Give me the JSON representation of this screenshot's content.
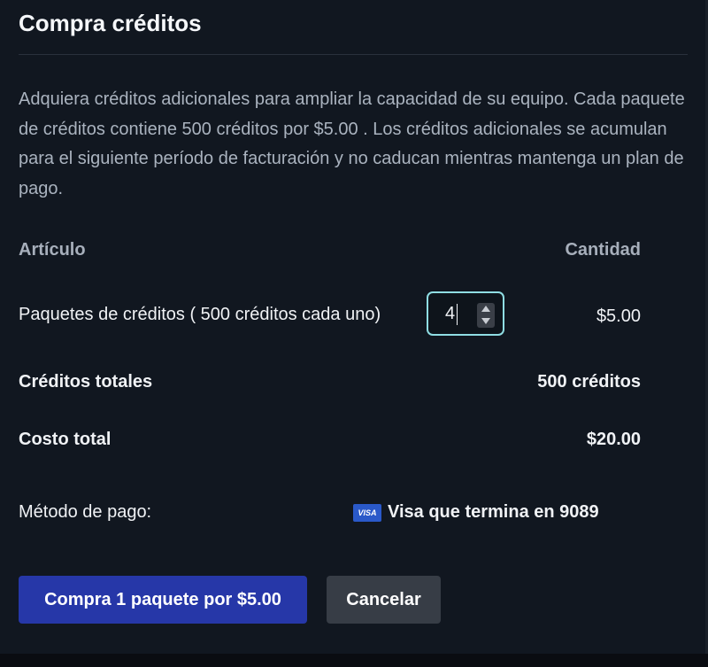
{
  "dialog": {
    "title": "Compra créditos",
    "description": "Adquiera créditos adicionales para ampliar la capacidad de su equipo. Cada paquete de créditos contiene 500 créditos por $5.00 . Los créditos adicionales se acumulan para el siguiente período de facturación y no caducan mientras mantenga un plan de pago."
  },
  "table": {
    "header_item": "Artículo",
    "header_quantity": "Cantidad",
    "package_label": "Paquetes de créditos ( 500 créditos cada uno)",
    "package_quantity": "4",
    "package_price": "$5.00",
    "total_credits_label": "Créditos totales",
    "total_credits_value": "500 créditos",
    "total_cost_label": "Costo total",
    "total_cost_value": "$20.00"
  },
  "payment": {
    "label": "Método de pago:",
    "card_brand": "VISA",
    "card_text": "Visa que termina en 9089",
    "card_icon": "visa-card-icon"
  },
  "actions": {
    "buy_label": "Compra 1 paquete por $5.00",
    "cancel_label": "Cancelar"
  },
  "colors": {
    "background": "#111720",
    "primary_button": "#2637a8",
    "secondary_button": "#373d46",
    "focus_ring": "#8fdde3",
    "visa_badge": "#2a59c9"
  }
}
